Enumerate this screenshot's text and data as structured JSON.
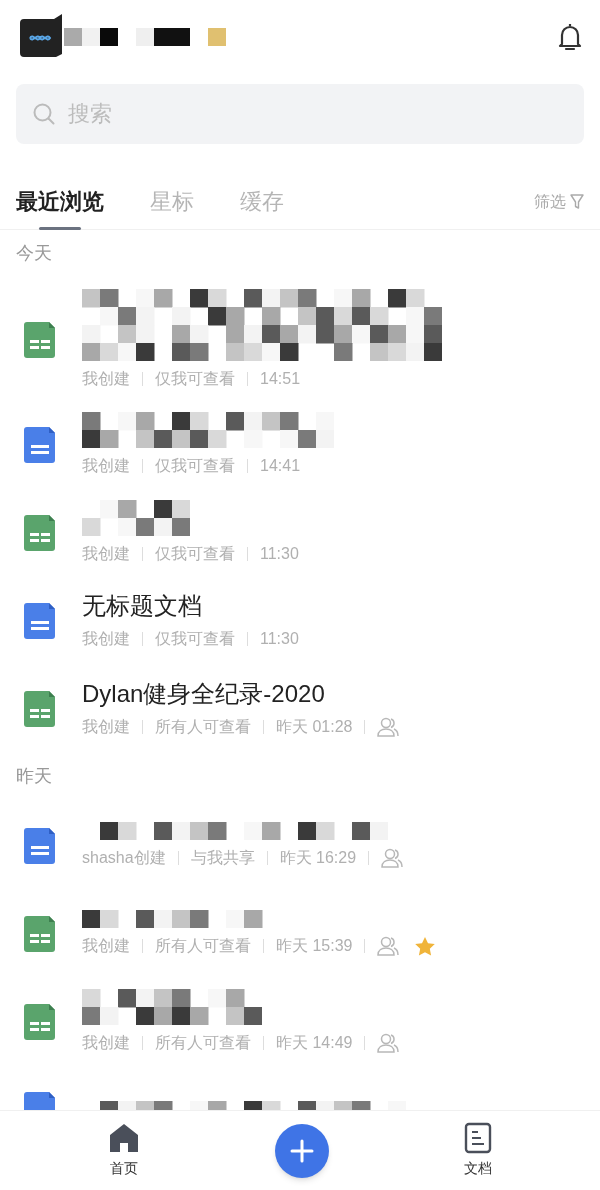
{
  "header": {
    "username_redacted": true
  },
  "search": {
    "placeholder": "搜索"
  },
  "tabs": [
    {
      "label": "最近浏览",
      "selected": true
    },
    {
      "label": "星标",
      "selected": false
    },
    {
      "label": "缓存",
      "selected": false
    }
  ],
  "filter": {
    "label": "筛选"
  },
  "sections": [
    {
      "heading": "今天",
      "items": [
        {
          "kind": "sheet",
          "redacted": true,
          "meta": [
            "我创建",
            "仅我可查看",
            "14:51"
          ],
          "shared": false,
          "starred": false
        },
        {
          "kind": "doc",
          "redacted": true,
          "meta": [
            "我创建",
            "仅我可查看",
            "14:41"
          ],
          "shared": false,
          "starred": false
        },
        {
          "kind": "sheet",
          "redacted": true,
          "meta": [
            "我创建",
            "仅我可查看",
            "11:30"
          ],
          "shared": false,
          "starred": false
        },
        {
          "kind": "doc",
          "redacted": false,
          "title": "无标题文档",
          "meta": [
            "我创建",
            "仅我可查看",
            "11:30"
          ],
          "shared": false,
          "starred": false
        },
        {
          "kind": "sheet",
          "redacted": false,
          "title": "Dylan健身全纪录-2020",
          "meta": [
            "我创建",
            "所有人可查看",
            "昨天 01:28"
          ],
          "shared": true,
          "starred": false
        }
      ]
    },
    {
      "heading": "昨天",
      "items": [
        {
          "kind": "doc",
          "redacted": true,
          "meta": [
            "shasha创建",
            "与我共享",
            "昨天 16:29"
          ],
          "shared": true,
          "starred": false
        },
        {
          "kind": "sheet",
          "redacted": true,
          "meta": [
            "我创建",
            "所有人可查看",
            "昨天 15:39"
          ],
          "shared": true,
          "starred": true
        },
        {
          "kind": "sheet",
          "redacted": true,
          "meta": [
            "我创建",
            "所有人可查看",
            "昨天 14:49"
          ],
          "shared": true,
          "starred": false
        },
        {
          "kind": "doc",
          "redacted": true
        }
      ]
    }
  ],
  "bottom_nav": [
    {
      "kind": "home",
      "label": "首页"
    },
    {
      "kind": "add"
    },
    {
      "kind": "docs",
      "label": "文档"
    }
  ]
}
